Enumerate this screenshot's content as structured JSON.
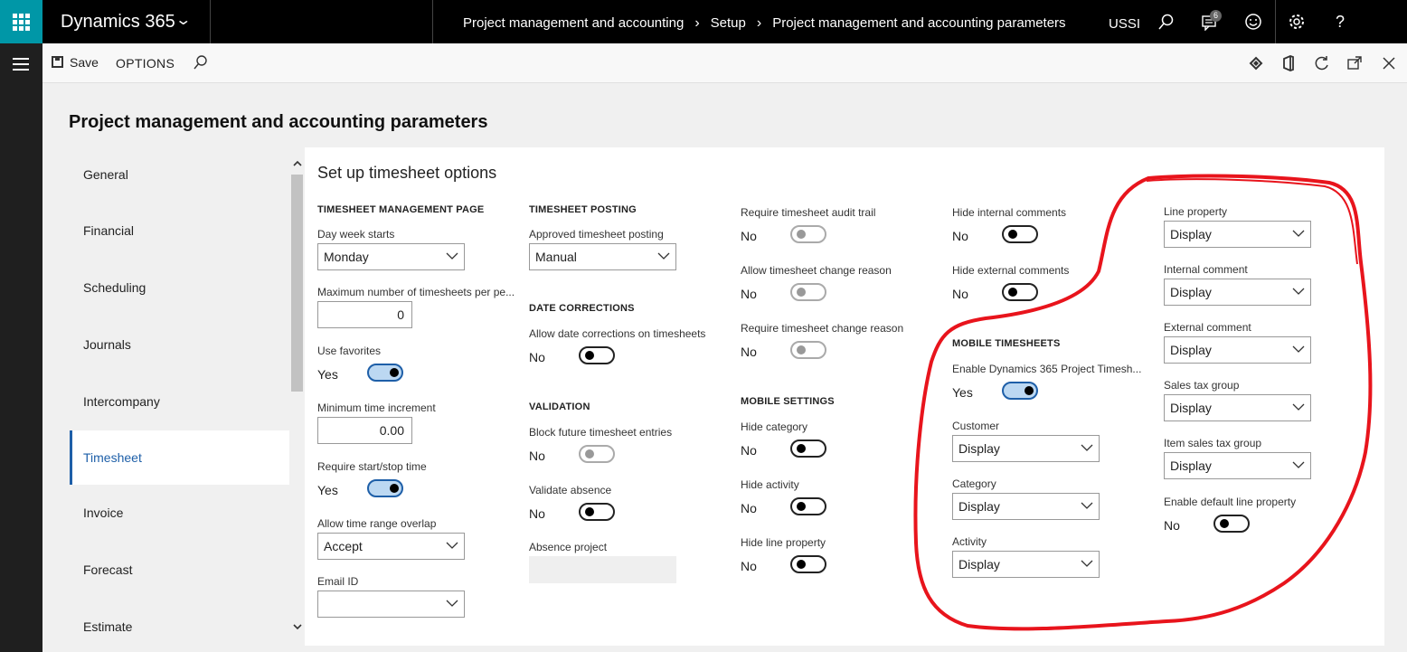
{
  "topbar": {
    "brand": "Dynamics 365",
    "breadcrumbs": [
      "Project management and accounting",
      "Setup",
      "Project management and accounting parameters"
    ],
    "company": "USSI",
    "notification_count": "6"
  },
  "actionbar": {
    "save_label": "Save",
    "options_label": "OPTIONS"
  },
  "page": {
    "title": "Project management and accounting parameters",
    "section_title": "Set up timesheet options"
  },
  "nav": {
    "items": [
      "General",
      "Financial",
      "Scheduling",
      "Journals",
      "Intercompany",
      "Timesheet",
      "Invoice",
      "Forecast",
      "Estimate"
    ],
    "active": "Timesheet"
  },
  "col1": {
    "header": "TIMESHEET MANAGEMENT PAGE",
    "day_week_starts_label": "Day week starts",
    "day_week_starts_value": "Monday",
    "max_timesheets_label": "Maximum number of timesheets per pe...",
    "max_timesheets_value": "0",
    "use_favorites_label": "Use favorites",
    "use_favorites_value": "Yes",
    "min_time_increment_label": "Minimum time increment",
    "min_time_increment_value": "0.00",
    "require_start_stop_label": "Require start/stop time",
    "require_start_stop_value": "Yes",
    "allow_overlap_label": "Allow time range overlap",
    "allow_overlap_value": "Accept",
    "email_id_label": "Email ID",
    "email_id_value": ""
  },
  "col2": {
    "posting_header": "TIMESHEET POSTING",
    "approved_posting_label": "Approved timesheet posting",
    "approved_posting_value": "Manual",
    "date_corrections_header": "DATE CORRECTIONS",
    "allow_date_corrections_label": "Allow date corrections on timesheets",
    "allow_date_corrections_value": "No",
    "validation_header": "VALIDATION",
    "block_future_label": "Block future timesheet entries",
    "block_future_value": "No",
    "validate_absence_label": "Validate absence",
    "validate_absence_value": "No",
    "absence_project_label": "Absence project"
  },
  "col3": {
    "audit_trail_label": "Require timesheet audit trail",
    "audit_trail_value": "No",
    "allow_change_reason_label": "Allow timesheet change reason",
    "allow_change_reason_value": "No",
    "require_change_reason_label": "Require timesheet change reason",
    "require_change_reason_value": "No",
    "mobile_settings_header": "MOBILE SETTINGS",
    "hide_category_label": "Hide category",
    "hide_category_value": "No",
    "hide_activity_label": "Hide activity",
    "hide_activity_value": "No",
    "hide_line_property_label": "Hide line property",
    "hide_line_property_value": "No"
  },
  "col4": {
    "hide_internal_label": "Hide internal comments",
    "hide_internal_value": "No",
    "hide_external_label": "Hide external comments",
    "hide_external_value": "No",
    "mobile_timesheets_header": "MOBILE TIMESHEETS",
    "enable_mobile_label": "Enable Dynamics 365 Project Timesh...",
    "enable_mobile_value": "Yes",
    "customer_label": "Customer",
    "customer_value": "Display",
    "category_label": "Category",
    "category_value": "Display",
    "activity_label": "Activity",
    "activity_value": "Display"
  },
  "col5": {
    "line_property_label": "Line property",
    "line_property_value": "Display",
    "internal_comment_label": "Internal comment",
    "internal_comment_value": "Display",
    "external_comment_label": "External comment",
    "external_comment_value": "Display",
    "sales_tax_group_label": "Sales tax group",
    "sales_tax_group_value": "Display",
    "item_sales_tax_group_label": "Item sales tax group",
    "item_sales_tax_group_value": "Display",
    "enable_default_line_property_label": "Enable default line property",
    "enable_default_line_property_value": "No"
  },
  "colors": {
    "accent": "#1e5fa8",
    "waffle": "#0097a7",
    "annotation": "#e8141c",
    "toggle_on_fill": "#bcd8f2"
  }
}
